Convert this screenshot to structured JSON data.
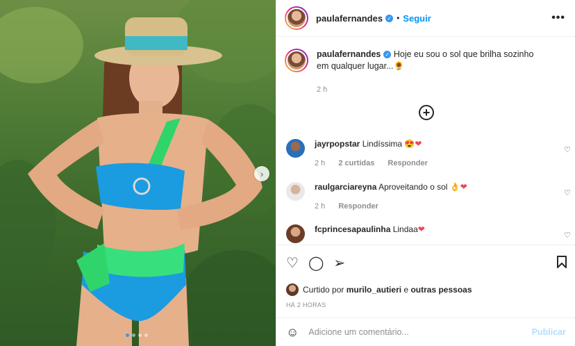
{
  "post": {
    "username": "paulafernandes",
    "follow_label": "Seguir",
    "more_label": "•••",
    "caption": "Hoje eu sou o sol que brilha sozinho em qualquer lugar...🌻",
    "caption_time": "2 h",
    "load_more_label": "+"
  },
  "comments": [
    {
      "user": "jayrpopstar",
      "text": "Lindíssima 😍",
      "emoji_heart": "❤",
      "time": "2 h",
      "likes": "2 curtidas",
      "reply": "Responder"
    },
    {
      "user": "raulgarciareyna",
      "text": "Aproveitando o sol 👌",
      "emoji_heart": "❤",
      "time": "2 h",
      "reply": "Responder"
    },
    {
      "user": "fcprincesapaulinha",
      "text": "Lindaa",
      "emoji_heart": "❤"
    }
  ],
  "actions": {
    "liked_prefix": "Curtido por",
    "liked_user": "murilo_autieri",
    "liked_join": "e",
    "liked_others": "outras pessoas",
    "posted_ago": "HÁ 2 HORAS"
  },
  "add_comment": {
    "placeholder": "Adicione um comentário...",
    "post_label": "Publicar"
  },
  "icons": {
    "verified": "verified-badge-icon",
    "heart": "heart-icon",
    "comment": "comment-icon",
    "share": "share-icon",
    "save": "bookmark-icon",
    "emoji": "emoji-icon",
    "next": "chevron-right-icon"
  },
  "colors": {
    "link_blue": "#0095f6",
    "verified_blue": "#3897f0",
    "muted": "#8e8e8e",
    "heart_red": "#ed4956",
    "disabled_blue": "#b2dffc"
  },
  "carousel": {
    "current": 1,
    "count": 4
  }
}
